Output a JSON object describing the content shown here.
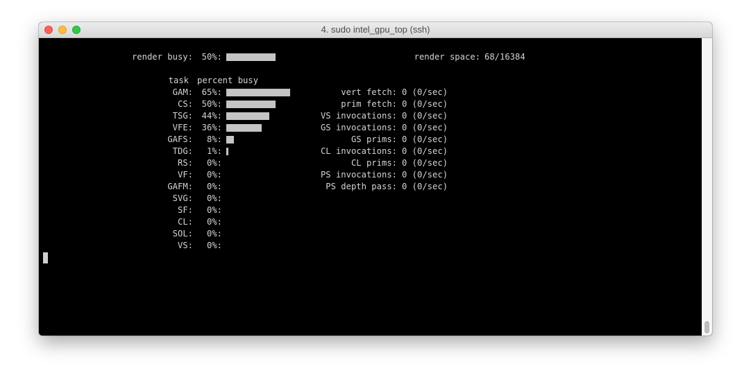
{
  "window": {
    "title": "4. sudo intel_gpu_top (ssh)"
  },
  "header": {
    "render_busy_label": "render busy:",
    "render_busy_percent": "50%:",
    "render_busy_value": 50,
    "render_space_label": "render space:",
    "render_space_value": "68/16384"
  },
  "tasks": {
    "col_task": "task",
    "col_percent": "percent busy",
    "rows": [
      {
        "name": "GAM:",
        "percent": "65%:",
        "value": 65
      },
      {
        "name": "CS:",
        "percent": "50%:",
        "value": 50
      },
      {
        "name": "TSG:",
        "percent": "44%:",
        "value": 44
      },
      {
        "name": "VFE:",
        "percent": "36%:",
        "value": 36
      },
      {
        "name": "GAFS:",
        "percent": "8%:",
        "value": 8
      },
      {
        "name": "TDG:",
        "percent": "1%:",
        "value": 1
      },
      {
        "name": "RS:",
        "percent": "0%:",
        "value": 0
      },
      {
        "name": "VF:",
        "percent": "0%:",
        "value": 0
      },
      {
        "name": "GAFM:",
        "percent": "0%:",
        "value": 0
      },
      {
        "name": "SVG:",
        "percent": "0%:",
        "value": 0
      },
      {
        "name": "SF:",
        "percent": "0%:",
        "value": 0
      },
      {
        "name": "CL:",
        "percent": "0%:",
        "value": 0
      },
      {
        "name": "SOL:",
        "percent": "0%:",
        "value": 0
      },
      {
        "name": "VS:",
        "percent": "0%:",
        "value": 0
      }
    ]
  },
  "counters": [
    {
      "label": "vert fetch:",
      "value": "0 (0/sec)"
    },
    {
      "label": "prim fetch:",
      "value": "0 (0/sec)"
    },
    {
      "label": "VS invocations:",
      "value": "0 (0/sec)"
    },
    {
      "label": "GS invocations:",
      "value": "0 (0/sec)"
    },
    {
      "label": "GS prims:",
      "value": "0 (0/sec)"
    },
    {
      "label": "CL invocations:",
      "value": "0 (0/sec)"
    },
    {
      "label": "CL prims:",
      "value": "0 (0/sec)"
    },
    {
      "label": "PS invocations:",
      "value": "0 (0/sec)"
    },
    {
      "label": "PS depth pass:",
      "value": "0 (0/sec)"
    }
  ]
}
